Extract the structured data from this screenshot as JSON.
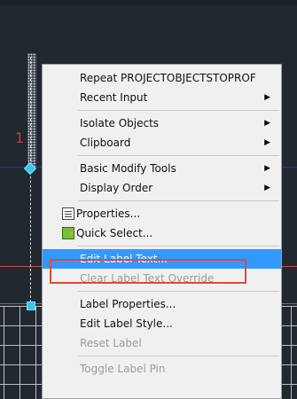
{
  "colors": {
    "canvas_bg": "#212830",
    "blue_line": "#1e2ee0",
    "red_line": "#c84a4a",
    "grip": "#35c8e8",
    "highlight": "#3399ff",
    "focus_outline": "#e04a3a"
  },
  "drawing": {
    "row_number": "1"
  },
  "context_menu": {
    "items": [
      {
        "label": "Repeat PROJECTOBJECTSTOPROF",
        "enabled": true,
        "submenu": false
      },
      {
        "label": "Recent Input",
        "enabled": true,
        "submenu": true
      },
      {
        "label": "Isolate Objects",
        "enabled": true,
        "submenu": true
      },
      {
        "label": "Clipboard",
        "enabled": true,
        "submenu": true
      },
      {
        "label": "Basic Modify Tools",
        "enabled": true,
        "submenu": true
      },
      {
        "label": "Display Order",
        "enabled": true,
        "submenu": true
      },
      {
        "label": "Properties...",
        "enabled": true,
        "submenu": false,
        "icon": "properties-icon"
      },
      {
        "label": "Quick Select...",
        "enabled": true,
        "submenu": false,
        "icon": "quick-select-icon"
      },
      {
        "label": "Edit Label Text...",
        "enabled": true,
        "submenu": false,
        "highlighted": true
      },
      {
        "label": "Clear Label Text Override",
        "enabled": false,
        "submenu": false
      },
      {
        "label": "Label Properties...",
        "enabled": true,
        "submenu": false
      },
      {
        "label": "Edit Label Style...",
        "enabled": true,
        "submenu": false
      },
      {
        "label": "Reset Label",
        "enabled": false,
        "submenu": false
      },
      {
        "label": "Toggle Label Pin",
        "enabled": false,
        "submenu": false
      }
    ]
  }
}
